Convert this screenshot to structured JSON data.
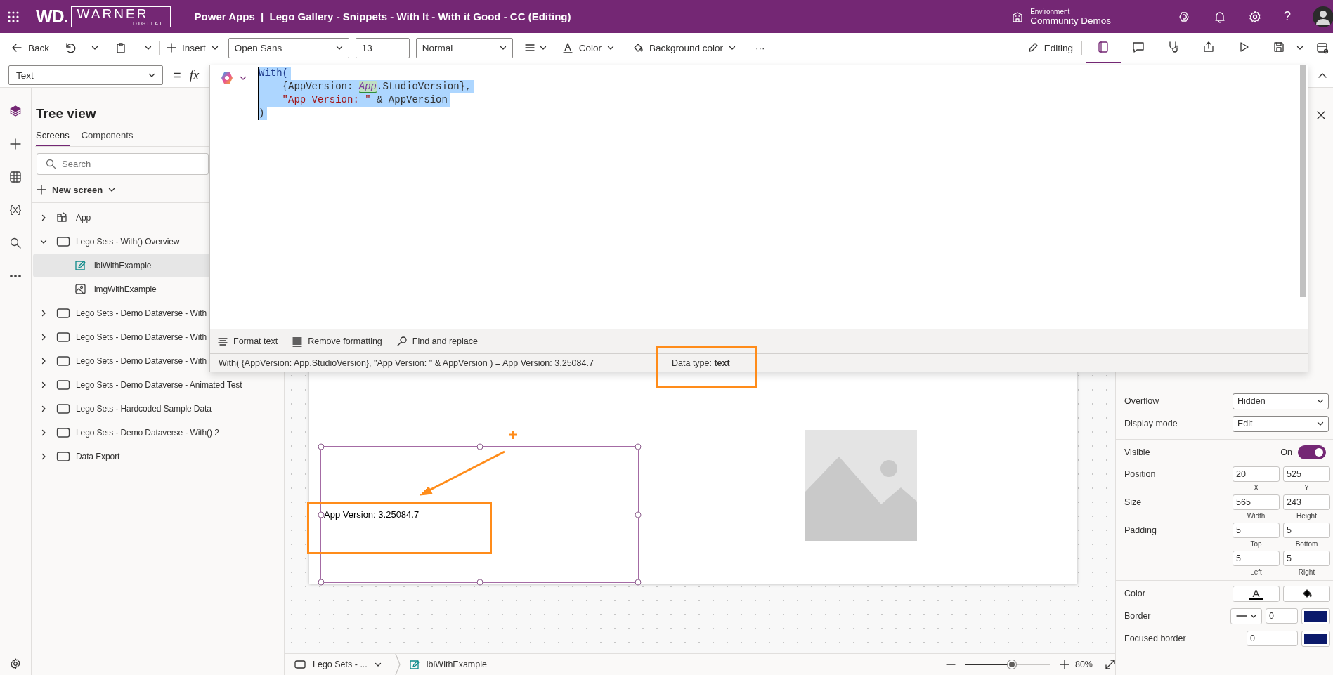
{
  "header": {
    "title": "Power Apps  |  Lego Gallery - Snippets - With It - With it Good - CC (Editing)",
    "logo": {
      "mark": "WD.",
      "name": "WARNER",
      "tagline": "DIGITAL"
    },
    "environment": {
      "label": "Environment",
      "name": "Community Demos"
    },
    "help": "?"
  },
  "toolbar": {
    "back": "Back",
    "insert": "Insert",
    "font": "Open Sans",
    "font_size": "13",
    "font_weight": "Normal",
    "color_label": "Color",
    "background_label": "Background color",
    "more": "···",
    "mode": "Editing",
    "tools": [
      {
        "kind": "tree",
        "selected": true
      },
      {
        "kind": "comment",
        "selected": false
      },
      {
        "kind": "checker",
        "selected": false
      },
      {
        "kind": "share",
        "selected": false
      },
      {
        "kind": "play",
        "selected": false
      },
      {
        "kind": "save",
        "selected": false
      }
    ]
  },
  "formula_bar": {
    "property": "Text",
    "equals": "=",
    "fx": "fx",
    "code_selected": true,
    "code": [
      {
        "indent": false,
        "tokens": [
          {
            "text": "With(",
            "kind": "function"
          }
        ]
      },
      {
        "indent": true,
        "tokens": [
          {
            "text": "{AppVersion: ",
            "kind": "plain"
          },
          {
            "text": "App",
            "kind": "object"
          },
          {
            "text": ".StudioVersion},",
            "kind": "plain"
          }
        ]
      },
      {
        "indent": true,
        "tokens": [
          {
            "text": "\"App Version: \"",
            "kind": "string"
          },
          {
            "text": " & AppVersion",
            "kind": "plain"
          }
        ]
      },
      {
        "indent": false,
        "tokens": [
          {
            "text": ")",
            "kind": "plain"
          }
        ]
      }
    ],
    "tools": [
      {
        "kind": "format",
        "label": "Format text"
      },
      {
        "kind": "remove",
        "label": "Remove formatting"
      },
      {
        "kind": "find",
        "label": "Find and replace"
      }
    ],
    "result": "With( {AppVersion: App.StudioVersion}, \"App Version: \" & AppVersion )  =  App Version: 3.25084.7",
    "data_type": "Data type: **text**"
  },
  "rail": [
    {
      "kind": "layers",
      "selected": true
    },
    {
      "kind": "add",
      "selected": false
    },
    {
      "kind": "table",
      "selected": false
    },
    {
      "kind": "variables",
      "glyph": "{x}",
      "selected": false
    },
    {
      "kind": "search",
      "selected": false
    },
    {
      "kind": "more",
      "selected": false
    }
  ],
  "tree_view": {
    "title": "Tree view",
    "tabs": [
      {
        "label": "Screens",
        "selected": true
      },
      {
        "label": "Components",
        "selected": false
      }
    ],
    "search": {
      "placeholder": "Search"
    },
    "new_screen": "New screen",
    "items": [
      {
        "label": "App",
        "kind": "app",
        "expanded": false,
        "selected": false
      },
      {
        "label": "Lego Sets - With() Overview",
        "kind": "screen",
        "expanded": true,
        "selected": false,
        "children": [
          {
            "label": "lblWithExample",
            "kind": "label",
            "selected": true
          },
          {
            "label": "imgWithExample",
            "kind": "image",
            "selected": false
          }
        ]
      },
      {
        "label": "Lego Sets - Demo Dataverse - With",
        "kind": "screen",
        "expanded": false,
        "selected": false
      },
      {
        "label": "Lego Sets - Demo Dataverse - With",
        "kind": "screen",
        "expanded": false,
        "selected": false
      },
      {
        "label": "Lego Sets - Demo Dataverse - With",
        "kind": "screen",
        "expanded": false,
        "selected": false
      },
      {
        "label": "Lego Sets - Demo Dataverse - Animated Test",
        "kind": "screen",
        "expanded": false,
        "selected": false
      },
      {
        "label": "Lego Sets - Hardcoded Sample Data",
        "kind": "screen",
        "expanded": false,
        "selected": false
      },
      {
        "label": "Lego Sets - Demo Dataverse - With() 2",
        "kind": "screen",
        "expanded": false,
        "selected": false
      },
      {
        "label": "Data Export",
        "kind": "screen",
        "expanded": false,
        "selected": false
      }
    ]
  },
  "canvas": {
    "label_text": "App Version: 3.25084.7"
  },
  "properties": {
    "groups": [
      [
        {
          "kind": "dropdown",
          "label": "Overflow",
          "value": "Hidden"
        },
        {
          "kind": "dropdown",
          "label": "Display mode",
          "value": "Edit"
        }
      ],
      [
        {
          "kind": "toggle",
          "label": "Visible",
          "value": "On",
          "on": true
        },
        {
          "kind": "pair",
          "label": "Position",
          "fields": [
            {
              "value": "20",
              "caption": "X"
            },
            {
              "value": "525",
              "caption": "Y"
            }
          ]
        },
        {
          "kind": "pair",
          "label": "Size",
          "fields": [
            {
              "value": "565",
              "caption": "Width"
            },
            {
              "value": "243",
              "caption": "Height"
            }
          ]
        },
        {
          "kind": "pair",
          "label": "Padding",
          "fields": [
            {
              "value": "5",
              "caption": "Top"
            },
            {
              "value": "5",
              "caption": "Bottom"
            }
          ]
        },
        {
          "kind": "pair",
          "fields": [
            {
              "value": "5",
              "caption": "Left"
            },
            {
              "value": "5",
              "caption": "Right"
            }
          ]
        }
      ],
      [
        {
          "kind": "color",
          "label": "Color",
          "glyph": "A"
        },
        {
          "kind": "border",
          "label": "Border",
          "value": "0",
          "color": "#0b1a6b"
        },
        {
          "kind": "focused",
          "label": "Focused border",
          "value": "0",
          "color": "#0b1a6b"
        }
      ]
    ]
  },
  "status_bar": {
    "screen": "Lego Sets - ...",
    "control": "lblWithExample",
    "zoom": "80%",
    "zoom_slider": {
      "level": 0.55
    }
  }
}
